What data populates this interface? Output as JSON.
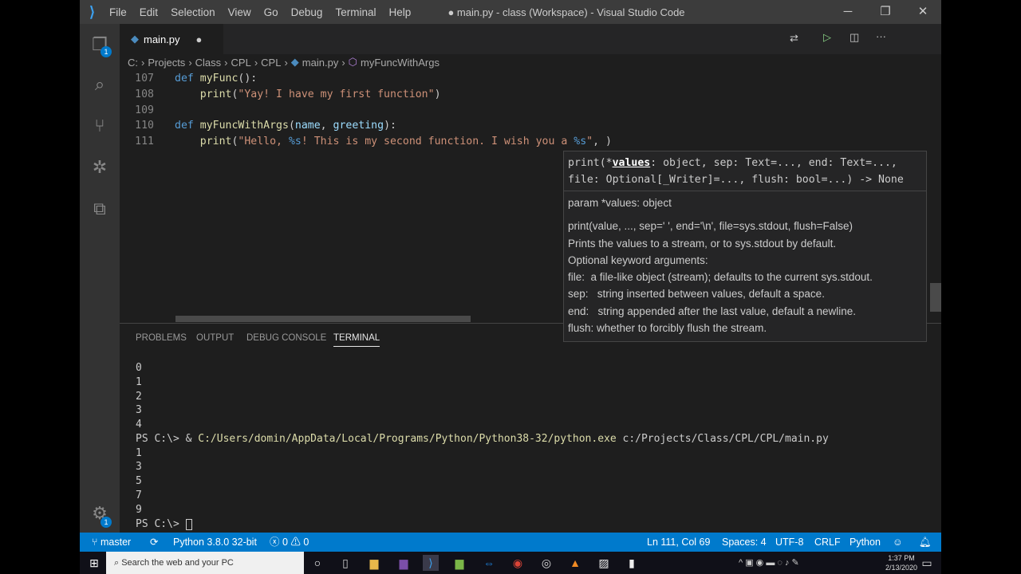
{
  "window": {
    "title": "● main.py - class (Workspace) - Visual Studio Code",
    "menu": [
      "File",
      "Edit",
      "Selection",
      "View",
      "Go",
      "Debug",
      "Terminal",
      "Help"
    ]
  },
  "activity": {
    "explorer_badge": "1"
  },
  "tab": {
    "label": "main.py",
    "modified": "●"
  },
  "breadcrumb": [
    "C:",
    "Projects",
    "Class",
    "CPL",
    "CPL",
    "main.py",
    "myFuncWithArgs"
  ],
  "editor": {
    "line_numbers": [
      "107",
      "108",
      "109",
      "110",
      "111"
    ]
  },
  "hover": {
    "sig_line1_a": "print(*",
    "sig_param": "values",
    "sig_line1_b": ": object, sep: Text=..., end: Text=...,",
    "sig_line2": "file: Optional[_Writer]=..., flush: bool=...) -> None",
    "doc": [
      "param *values: object",
      "print(value, ..., sep=' ', end='\\n', file=sys.stdout, flush=False)",
      "Prints the values to a stream, or to sys.stdout by default.",
      "Optional keyword arguments:",
      "file:  a file-like object (stream); defaults to the current sys.stdout.",
      "sep:   string inserted between values, default a space.",
      "end:   string appended after the last value, default a newline.",
      "flush: whether to forcibly flush the stream."
    ]
  },
  "panel": {
    "tabs": [
      "PROBLEMS",
      "OUTPUT",
      "DEBUG CONSOLE",
      "TERMINAL"
    ],
    "terminal": [
      "0",
      "1",
      "2",
      "3",
      "4"
    ],
    "cmd_prompt": "PS C:\\> & ",
    "cmd_exe": "C:/Users/domin/AppData/Local/Programs/Python/Python38-32/python.exe",
    "cmd_arg": " c:/Projects/Class/CPL/CPL/main.py",
    "terminal2": [
      "1",
      "3",
      "5",
      "7",
      "9"
    ],
    "prompt": "PS C:\\> "
  },
  "status": {
    "branch": "master",
    "python": "Python 3.8.0 32-bit",
    "errors": "0",
    "warnings": "0",
    "position": "Ln 111, Col 69",
    "spaces": "Spaces: 4",
    "encoding": "UTF-8",
    "eol": "CRLF",
    "language": "Python"
  },
  "taskbar": {
    "search": "Search the web and your PC",
    "time": "1:37 PM",
    "date": "2/13/2020"
  }
}
